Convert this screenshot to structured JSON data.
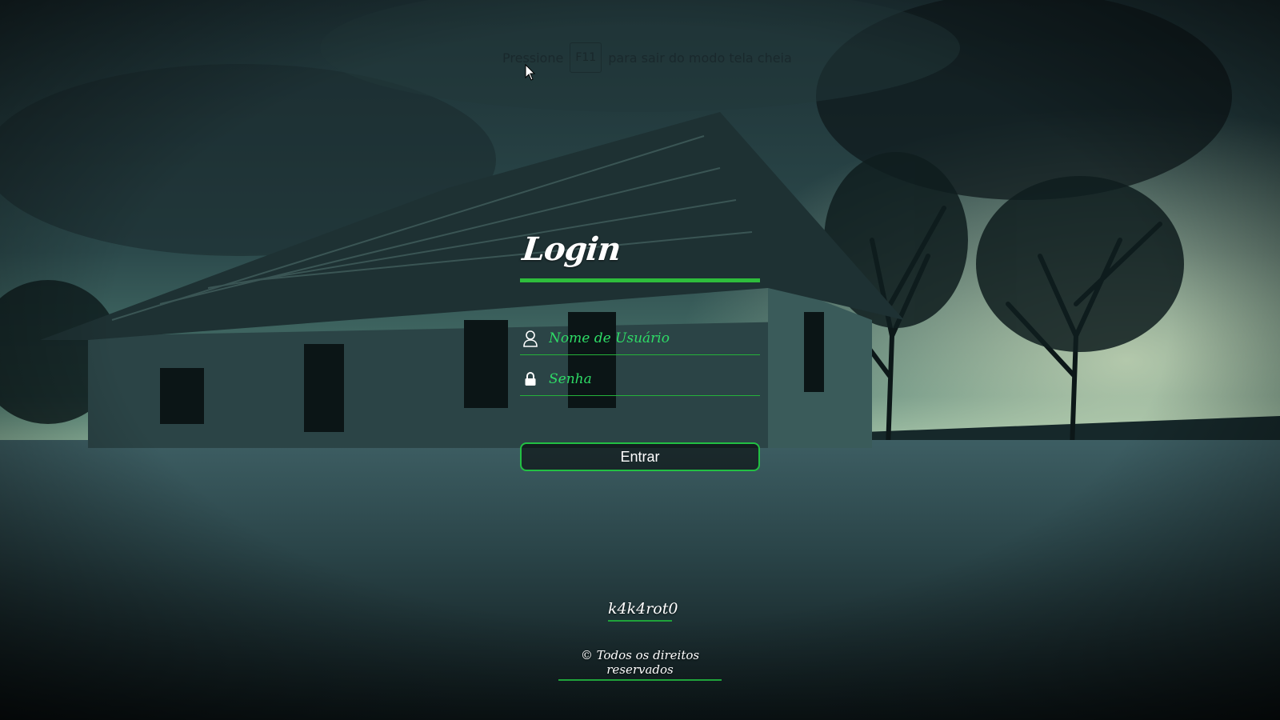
{
  "fullscreen_hint": {
    "before": "Pressione",
    "key": "F11",
    "after": "para sair do modo tela cheia"
  },
  "login": {
    "title": "Login",
    "username_placeholder": "Nome de Usuário",
    "password_placeholder": "Senha",
    "submit_label": "Entrar",
    "user_icon": "user-icon",
    "lock_icon": "lock-icon"
  },
  "footer": {
    "author": "k4k4rot0",
    "rights": "© Todos os direitos reservados"
  },
  "colors": {
    "accent": "#2ebd3c",
    "placeholder": "#2edb66",
    "text": "#ffffff"
  }
}
